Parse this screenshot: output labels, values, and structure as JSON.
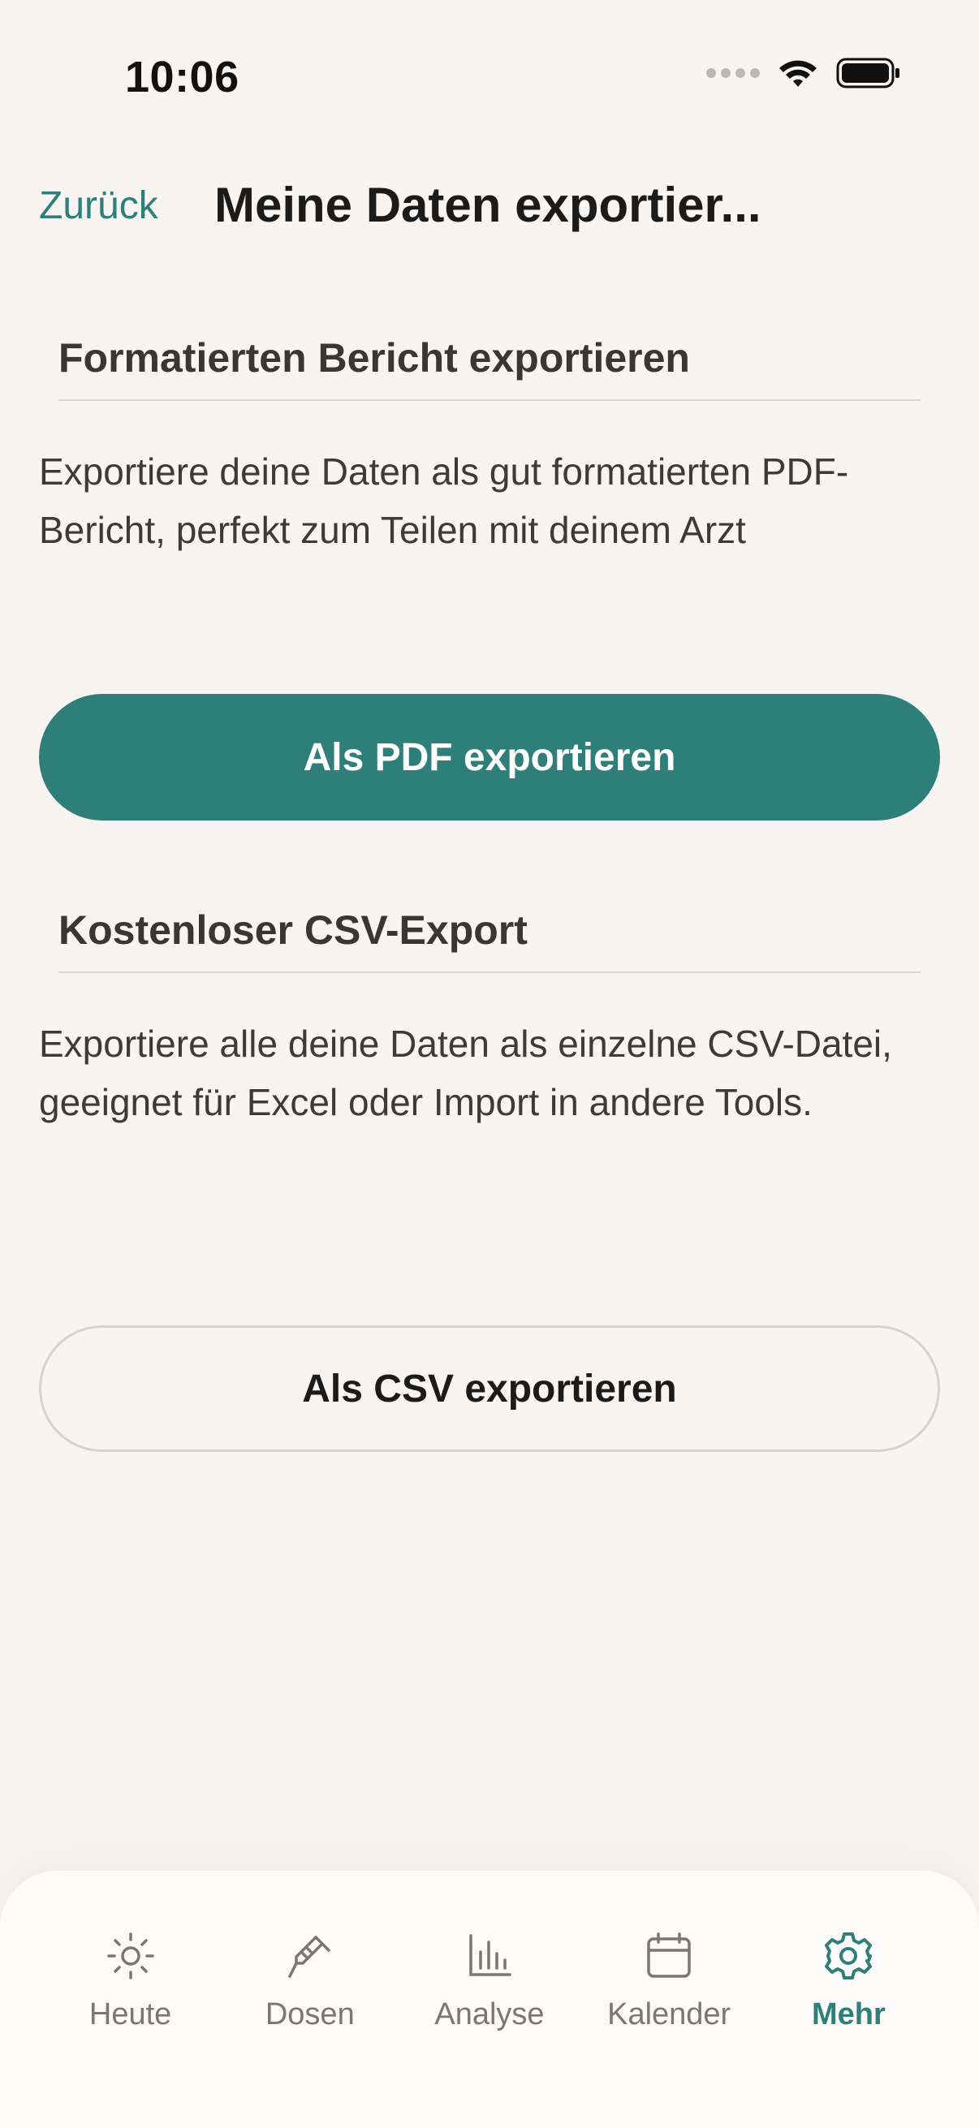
{
  "status_bar": {
    "time": "10:06"
  },
  "header": {
    "back_label": "Zurück",
    "title": "Meine Daten exportier..."
  },
  "pdf_section": {
    "heading": "Formatierten Bericht exportieren",
    "description": "Exportiere deine Daten als gut formatierten PDF-Bericht, perfekt zum Teilen mit deinem Arzt",
    "button_label": "Als PDF exportieren"
  },
  "csv_section": {
    "heading": "Kostenloser CSV-Export",
    "description": "Exportiere alle deine Daten als einzelne CSV-Datei, geeignet für Excel oder Import in andere Tools.",
    "button_label": "Als CSV exportieren"
  },
  "tab_bar": {
    "active": "Mehr",
    "items": [
      {
        "label": "Heute",
        "icon": "sun-icon"
      },
      {
        "label": "Dosen",
        "icon": "syringe-icon"
      },
      {
        "label": "Analyse",
        "icon": "bar-chart-icon"
      },
      {
        "label": "Kalender",
        "icon": "calendar-icon"
      },
      {
        "label": "Mehr",
        "icon": "gear-icon"
      }
    ]
  },
  "colors": {
    "accent": "#2e7e7a",
    "background": "#f7f4f1",
    "tab_inactive": "#7b7671"
  }
}
